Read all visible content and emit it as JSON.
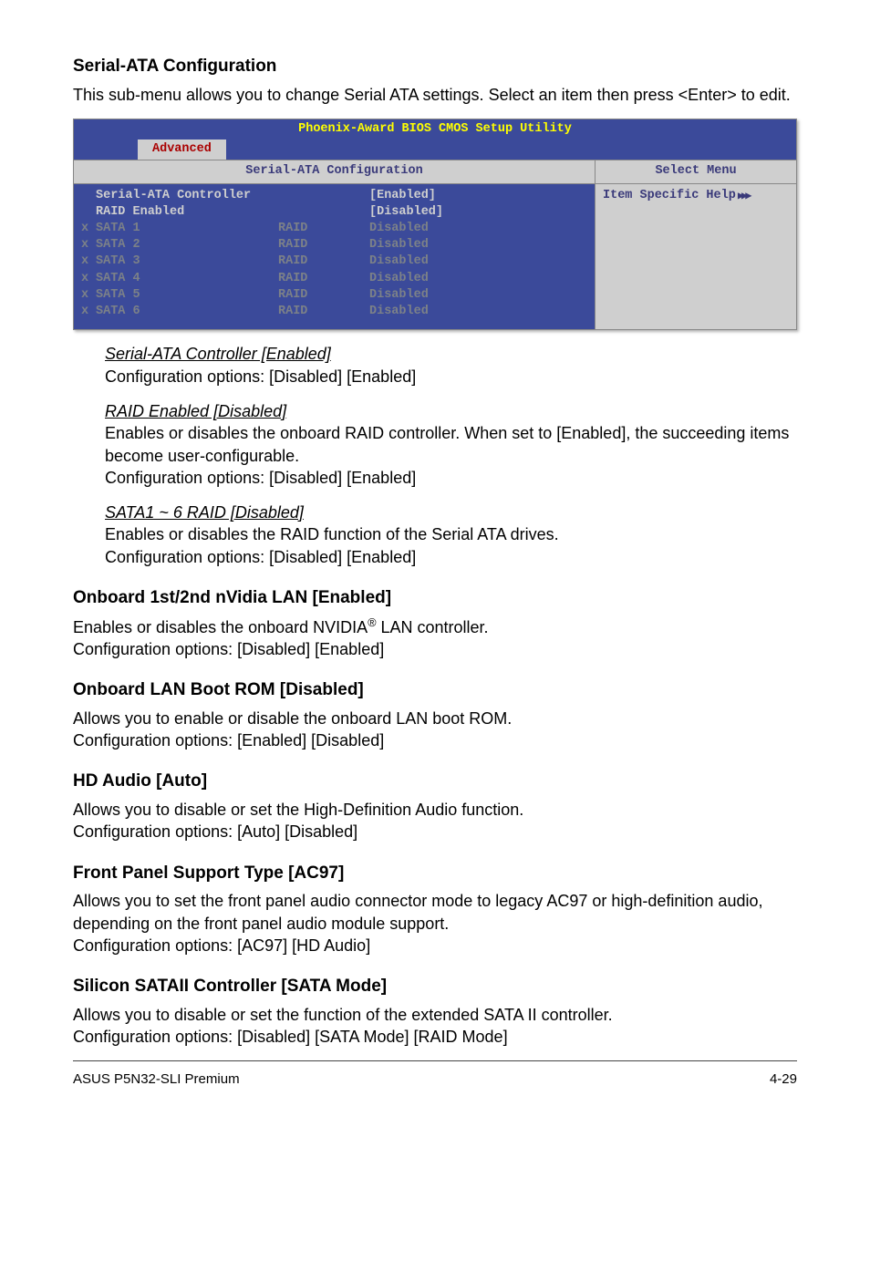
{
  "sections": {
    "serial_ata": {
      "heading": "Serial-ATA Configuration",
      "intro": "This sub-menu allows you to change Serial ATA settings. Select an item then press <Enter> to edit."
    },
    "bios": {
      "title": "Phoenix-Award BIOS CMOS Setup Utility",
      "tab": "Advanced",
      "left_header": "Serial-ATA Configuration",
      "right_header": "Select Menu",
      "help": "Item Specific Help",
      "settings": [
        {
          "label": "Serial-ATA Controller",
          "value": "[Enabled]"
        },
        {
          "label": "RAID Enabled",
          "value": "[Disabled]"
        }
      ],
      "rows": [
        {
          "x": "x",
          "c1": "SATA 1",
          "c2": "RAID",
          "c3": "Disabled"
        },
        {
          "x": "x",
          "c1": "SATA 2",
          "c2": "RAID",
          "c3": "Disabled"
        },
        {
          "x": "x",
          "c1": "SATA 3",
          "c2": "RAID",
          "c3": "Disabled"
        },
        {
          "x": "x",
          "c1": "SATA 4",
          "c2": "RAID",
          "c3": "Disabled"
        },
        {
          "x": "x",
          "c1": "SATA 5",
          "c2": "RAID",
          "c3": "Disabled"
        },
        {
          "x": "x",
          "c1": "SATA 6",
          "c2": "RAID",
          "c3": "Disabled"
        }
      ]
    },
    "subitems": {
      "s1": {
        "title": "Serial-ATA Controller [Enabled]",
        "body": "Configuration options: [Disabled] [Enabled]"
      },
      "s2": {
        "title": "RAID Enabled [Disabled]",
        "body1": "Enables or disables the onboard RAID controller. When set to [Enabled], the succeeding items become user-configurable.",
        "body2": "Configuration options: [Disabled] [Enabled]"
      },
      "s3": {
        "title": "SATA1 ~ 6 RAID [Disabled]",
        "body1": "Enables or disables the RAID function of the Serial ATA drives.",
        "body2": "Configuration options: [Disabled] [Enabled]"
      }
    },
    "lan": {
      "heading": "Onboard 1st/2nd nVidia LAN [Enabled]",
      "body1a": "Enables or disables the onboard NVIDIA",
      "body1b": " LAN controller.",
      "body2": "Configuration options: [Disabled] [Enabled]"
    },
    "lanrom": {
      "heading": "Onboard LAN Boot ROM [Disabled]",
      "body1": "Allows you to enable or disable the onboard LAN boot ROM.",
      "body2": "Configuration options: [Enabled] [Disabled]"
    },
    "hdaudio": {
      "heading": "HD Audio [Auto]",
      "body1": "Allows you to disable or set the High-Definition Audio function.",
      "body2": "Configuration options: [Auto] [Disabled]"
    },
    "frontpanel": {
      "heading": "Front Panel Support Type [AC97]",
      "body1": "Allows you to set the front panel audio connector mode to legacy AC97 or high-definition audio, depending on the front panel audio module support.",
      "body2": "Configuration options: [AC97] [HD Audio]"
    },
    "silicon": {
      "heading": "Silicon SATAII Controller [SATA Mode]",
      "body1": "Allows you to disable or set the function of the extended SATA II controller.",
      "body2": "Configuration options: [Disabled] [SATA Mode] [RAID Mode]"
    }
  },
  "footer": {
    "left": "ASUS P5N32-SLI Premium",
    "right": "4-29"
  },
  "glyphs": {
    "reg": "®",
    "arrows": "▶▶▶"
  }
}
